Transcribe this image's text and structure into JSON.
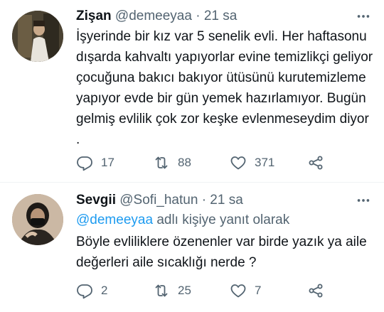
{
  "tweets": [
    {
      "name": "Zişan",
      "handle": "@demeeyaa",
      "separator": "·",
      "time": "21 sa",
      "text": "İşyerinde bir kız var 5 senelik evli. Her haftasonu dışarda kahvaltı yapıyorlar evine temizlikçi geliyor çocuğuna bakıcı bakıyor ütüsünü kurutemizleme yapıyor evde bir gün yemek hazırlamıyor. Bugün gelmiş evlilik çok zor keşke evlenmeseydim diyor .",
      "stats": {
        "replies": "17",
        "retweets": "88",
        "likes": "371"
      }
    },
    {
      "name": "Sevgii",
      "handle": "@Sofi_hatun",
      "separator": "·",
      "time": "21 sa",
      "reply_to_mention": "@demeeyaa",
      "reply_to_suffix": "adlı kişiye yanıt olarak",
      "text": "Böyle evliliklere özenenler var birde yazık ya aile değerleri aile sıcaklığı nerde ?",
      "stats": {
        "replies": "2",
        "retweets": "25",
        "likes": "7"
      }
    }
  ],
  "colors": {
    "text": "#0f1419",
    "secondary": "#536471",
    "accent": "#1d9bf0",
    "divider": "#eff3f4"
  },
  "icons": [
    "more-icon",
    "reply-icon",
    "retweet-icon",
    "like-icon",
    "share-icon"
  ]
}
